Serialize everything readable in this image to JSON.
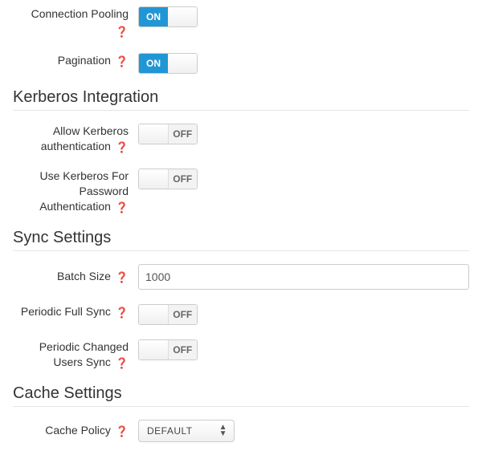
{
  "toggle_labels": {
    "on": "ON",
    "off": "OFF"
  },
  "general": {
    "connection_pooling": {
      "label": "Connection Pooling",
      "value": true
    },
    "pagination": {
      "label": "Pagination",
      "value": true
    }
  },
  "sections": {
    "kerberos": {
      "title": "Kerberos Integration",
      "allow_auth": {
        "label": "Allow Kerberos authentication",
        "value": false
      },
      "use_for_password": {
        "label": "Use Kerberos For Password Authentication",
        "value": false
      }
    },
    "sync": {
      "title": "Sync Settings",
      "batch_size": {
        "label": "Batch Size",
        "value": "1000"
      },
      "periodic_full": {
        "label": "Periodic Full Sync",
        "value": false
      },
      "periodic_changed": {
        "label": "Periodic Changed Users Sync",
        "value": false
      }
    },
    "cache": {
      "title": "Cache Settings",
      "cache_policy": {
        "label": "Cache Policy",
        "value": "DEFAULT"
      }
    }
  }
}
